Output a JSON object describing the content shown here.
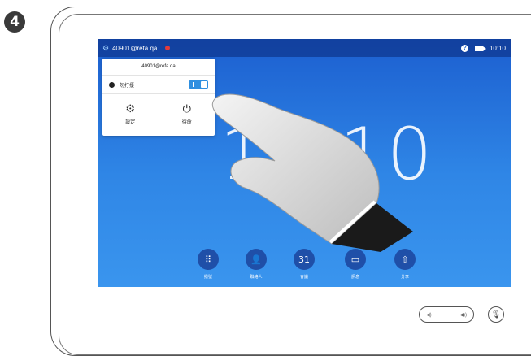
{
  "step_number": "4",
  "status_bar": {
    "uri": "40901@refa.qa",
    "time": "10:10",
    "icons": [
      "gear-icon",
      "record-dot-icon",
      "help-icon",
      "camera-icon"
    ]
  },
  "clock_overlay": "10:10",
  "popup": {
    "address": "40901@refa.qa",
    "dnd_label": "勿打擾",
    "dnd_enabled": true,
    "settings_label": "設定",
    "standby_label": "待命"
  },
  "dock": [
    {
      "label": "撥號",
      "icon": "keypad-icon",
      "glyph": "⠿"
    },
    {
      "label": "聯絡人",
      "icon": "contacts-icon",
      "glyph": "👤"
    },
    {
      "label": "會議",
      "icon": "calendar-icon",
      "glyph": "31"
    },
    {
      "label": "訊息",
      "icon": "voicemail-icon",
      "glyph": "▭"
    },
    {
      "label": "分享",
      "icon": "share-icon",
      "glyph": "⇧"
    }
  ],
  "colors": {
    "screen_top": "#1c5fd0",
    "screen_bottom": "#3a95ee",
    "toggle_on": "#2f8fe0",
    "record_dot": "#e23b3b"
  }
}
